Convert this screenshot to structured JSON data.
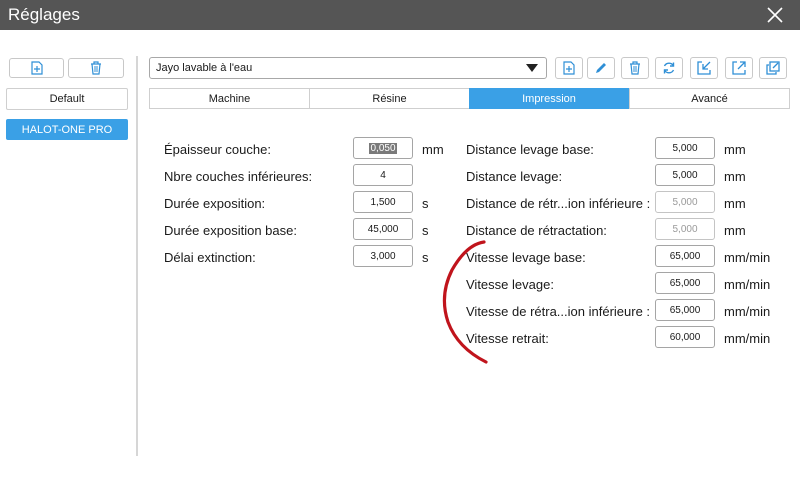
{
  "window": {
    "title": "Réglages"
  },
  "sidebar": {
    "add_icon": "file-plus-icon",
    "delete_icon": "trash-icon",
    "default_label": "Default",
    "printer_label": "HALOT-ONE PRO"
  },
  "profile": {
    "selected": "Jayo lavable à l'eau",
    "toolbar_icons": [
      "file-plus-icon",
      "pencil-icon",
      "trash-icon",
      "refresh-icon",
      "import-icon",
      "export-icon",
      "share-icon"
    ]
  },
  "tabs": [
    {
      "label": "Machine",
      "active": false
    },
    {
      "label": "Résine",
      "active": false
    },
    {
      "label": "Impression",
      "active": true
    },
    {
      "label": "Avancé",
      "active": false
    }
  ],
  "left_fields": [
    {
      "label": "Épaisseur couche:",
      "value": "0,050",
      "unit": "mm"
    },
    {
      "label": "Nbre couches inférieures:",
      "value": "4",
      "unit": ""
    },
    {
      "label": "Durée exposition:",
      "value": "1,500",
      "unit": "s"
    },
    {
      "label": "Durée exposition base:",
      "value": "45,000",
      "unit": "s"
    },
    {
      "label": "Délai extinction:",
      "value": "3,000",
      "unit": "s"
    }
  ],
  "right_fields": [
    {
      "label": "Distance levage base:",
      "value": "5,000",
      "unit": "mm",
      "disabled": false
    },
    {
      "label": "Distance levage:",
      "value": "5,000",
      "unit": "mm",
      "disabled": false
    },
    {
      "label": "Distance de rétr...ion inférieure :",
      "value": "5,000",
      "unit": "mm",
      "disabled": true
    },
    {
      "label": "Distance de rétractation:",
      "value": "5,000",
      "unit": "mm",
      "disabled": true
    },
    {
      "label": "Vitesse levage base:",
      "value": "65,000",
      "unit": "mm/min",
      "disabled": false
    },
    {
      "label": "Vitesse levage:",
      "value": "65,000",
      "unit": "mm/min",
      "disabled": false
    },
    {
      "label": "Vitesse de rétra...ion inférieure :",
      "value": "65,000",
      "unit": "mm/min",
      "disabled": false
    },
    {
      "label": "Vitesse retrait:",
      "value": "60,000",
      "unit": "mm/min",
      "disabled": false
    }
  ],
  "colors": {
    "accent": "#3aa0e6",
    "titlebar": "#555555",
    "annotation": "#c0141c"
  }
}
